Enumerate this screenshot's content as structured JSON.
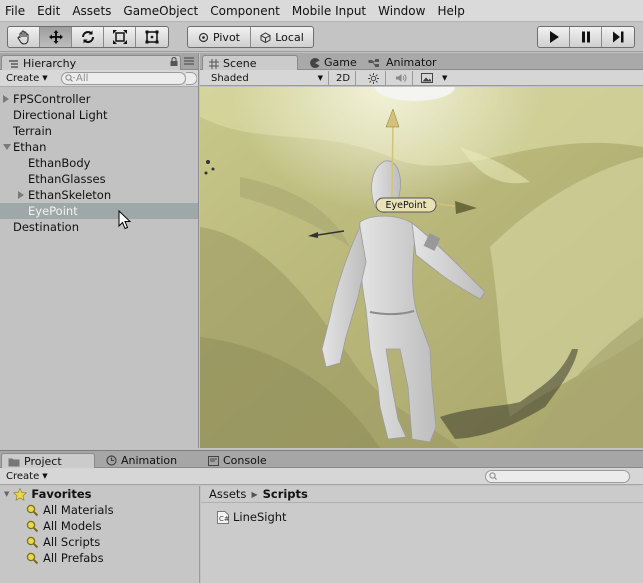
{
  "menu": [
    "File",
    "Edit",
    "Assets",
    "GameObject",
    "Component",
    "Mobile Input",
    "Window",
    "Help"
  ],
  "toolbar": {
    "tools": [
      {
        "icon": "hand-icon",
        "active": false
      },
      {
        "icon": "move-icon",
        "active": true
      },
      {
        "icon": "rotate-icon",
        "active": false
      },
      {
        "icon": "scale-icon",
        "active": false
      },
      {
        "icon": "rect-icon",
        "active": false
      }
    ],
    "pivot_label": "Pivot",
    "local_label": "Local",
    "play_controls": [
      "play-icon",
      "pause-icon",
      "step-icon"
    ]
  },
  "hierarchy": {
    "tab_label": "Hierarchy",
    "create_label": "Create",
    "search_placeholder": "All",
    "items": [
      {
        "label": "FPSController",
        "indent": 0,
        "arrow": "right",
        "selected": false
      },
      {
        "label": "Directional Light",
        "indent": 0,
        "arrow": "",
        "selected": false
      },
      {
        "label": "Terrain",
        "indent": 0,
        "arrow": "",
        "selected": false
      },
      {
        "label": "Ethan",
        "indent": 0,
        "arrow": "down",
        "selected": false
      },
      {
        "label": "EthanBody",
        "indent": 1,
        "arrow": "",
        "selected": false
      },
      {
        "label": "EthanGlasses",
        "indent": 1,
        "arrow": "",
        "selected": false
      },
      {
        "label": "EthanSkeleton",
        "indent": 1,
        "arrow": "right",
        "selected": false
      },
      {
        "label": "EyePoint",
        "indent": 1,
        "arrow": "",
        "selected": true
      },
      {
        "label": "Destination",
        "indent": 0,
        "arrow": "",
        "selected": false
      }
    ]
  },
  "scene": {
    "tabs": [
      {
        "label": "Scene",
        "icon": "grid-icon",
        "active": true
      },
      {
        "label": "Game",
        "icon": "pacman-icon",
        "active": false
      },
      {
        "label": "Animator",
        "icon": "animator-icon",
        "active": false
      }
    ],
    "shading_mode": "Shaded",
    "mode_2d": "2D",
    "gizmo_label": "EyePoint"
  },
  "bottom": {
    "tabs": [
      {
        "label": "Project",
        "icon": "folder-icon",
        "active": true
      },
      {
        "label": "Animation",
        "icon": "clock-icon",
        "active": false
      },
      {
        "label": "Console",
        "icon": "console-icon",
        "active": false
      }
    ],
    "create_label": "Create",
    "favorites_label": "Favorites",
    "favorites": [
      "All Materials",
      "All Models",
      "All Scripts",
      "All Prefabs"
    ],
    "breadcrumb_root": "Assets",
    "breadcrumb_current": "Scripts",
    "files": [
      "LineSight"
    ]
  },
  "colors": {
    "selection": "#9fa8a8",
    "terrain_light": "#dcdca0",
    "terrain_dark": "#8c8a58",
    "gizmo_arrow": "#d4c27a"
  }
}
